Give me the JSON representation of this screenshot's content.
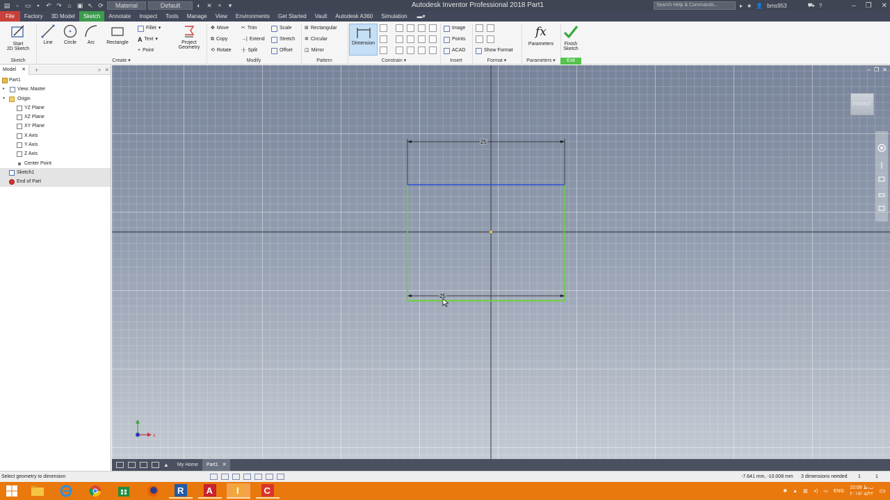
{
  "titlebar": {
    "title": "Autodesk Inventor Professional 2018    Part1",
    "material_combo": "Material",
    "appearance_combo": "Default",
    "search_placeholder": "Search Help & Commands...",
    "user": "bms953"
  },
  "menu_tabs": [
    "File",
    "Factory",
    "3D Model",
    "Sketch",
    "Annotate",
    "Inspect",
    "Tools",
    "Manage",
    "View",
    "Environments",
    "Get Started",
    "Vault",
    "Autodesk A360",
    "Simulation"
  ],
  "active_tab": "Sketch",
  "ribbon": {
    "sketch_panel": {
      "label": "Sketch",
      "start_line1": "Start",
      "start_line2": "2D Sketch"
    },
    "create_panel": {
      "label": "Create",
      "line": "Line",
      "circle": "Circle",
      "arc": "Arc",
      "rectangle": "Rectangle",
      "fillet": "Fillet",
      "text": "Text",
      "point": "Point",
      "project_line1": "Project",
      "project_line2": "Geometry"
    },
    "modify_panel": {
      "label": "Modify",
      "move": "Move",
      "copy": "Copy",
      "rotate": "Rotate",
      "trim": "Trim",
      "extend": "Extend",
      "split": "Split",
      "scale": "Scale",
      "stretch": "Stretch",
      "offset": "Offset"
    },
    "pattern_panel": {
      "label": "Pattern",
      "rectangular": "Rectangular",
      "circular": "Circular",
      "mirror": "Mirror"
    },
    "constrain_panel": {
      "label": "Constrain",
      "dimension": "Dimension"
    },
    "insert_panel": {
      "label": "Insert",
      "image": "Image",
      "points": "Points",
      "acad": "ACAD"
    },
    "format_panel": {
      "label": "Format",
      "show_format": "Show Format"
    },
    "parameters_panel": {
      "label": "Parameters",
      "parameters": "Parameters",
      "fx": "fx"
    },
    "exit_panel": {
      "label": "Exit",
      "finish_line1": "Finish",
      "finish_line2": "Sketch"
    }
  },
  "browser": {
    "tab": "Model",
    "tree": [
      {
        "label": "Part1",
        "indent": 0
      },
      {
        "label": "View: Master",
        "indent": 1
      },
      {
        "label": "Origin",
        "indent": 1
      },
      {
        "label": "YZ Plane",
        "indent": 2
      },
      {
        "label": "XZ Plane",
        "indent": 2
      },
      {
        "label": "XY Plane",
        "indent": 2
      },
      {
        "label": "X Axis",
        "indent": 2
      },
      {
        "label": "Y Axis",
        "indent": 2
      },
      {
        "label": "Z Axis",
        "indent": 2
      },
      {
        "label": "Center Point",
        "indent": 2
      },
      {
        "label": "Sketch1",
        "indent": 1
      },
      {
        "label": "End of Part",
        "indent": 1
      }
    ]
  },
  "viewport": {
    "viewcube_label": "FRONT",
    "top_dimension": "25",
    "bottom_dimension": "25",
    "axis_x": "x",
    "colors": {
      "rectangle": "#6bd23c",
      "selected_line": "#2f4fd6",
      "dimension": "#1a1a1a"
    }
  },
  "doc_tabs": {
    "home": "My Home",
    "part": "Part1"
  },
  "status": {
    "message": "Select geometry to dimension",
    "coords": "-7.641 mm, -10.008 mm",
    "dims_needed": "3 dimensions needed",
    "n1": "1",
    "n2": "1"
  },
  "taskbar": {
    "apps": [
      "start",
      "file-explorer",
      "internet-explorer",
      "chrome",
      "store",
      "firefox",
      "revit",
      "autocad",
      "inventor",
      "c-app"
    ],
    "lang": "ENG",
    "time": "10:08 ب.ظ",
    "date": "۲۰۱۷/۰۵/۲۲"
  },
  "accent": {
    "file_tab": "#c8403a",
    "active_tab": "#3c9a4e",
    "taskbar": "#e9780d"
  }
}
